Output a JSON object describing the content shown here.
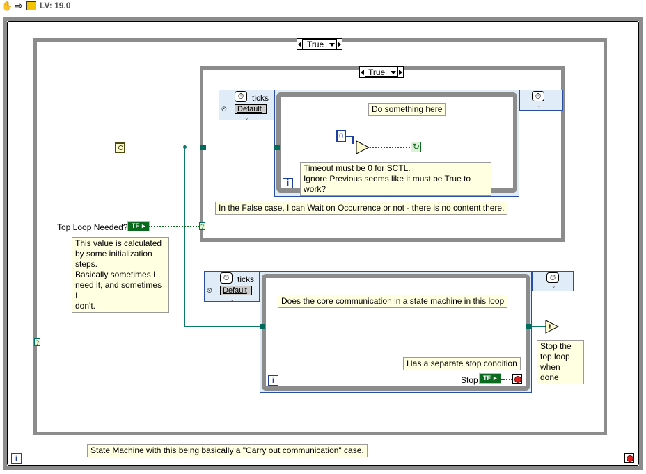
{
  "toolbar": {
    "version": "LV: 19.0",
    "icons": [
      "hand-icon",
      "arrow-icon",
      "lv-logo-icon"
    ]
  },
  "outer_case": {
    "selector_value": "True"
  },
  "inner_case": {
    "selector_value": "True"
  },
  "top_sctl": {
    "timing_ticks": "ticks",
    "timing_source": "Default",
    "comment_do": "Do something here",
    "constant_zero": "0",
    "comment_timeout_1": "Timeout must be 0 for SCTL.",
    "comment_timeout_2": "Ignore Previous seems like it must be True to work?",
    "iteration": "i"
  },
  "comment_false_case": "In the False case, I can Wait on Occurrence or not - there is no content there.",
  "top_loop_needed": {
    "label": "Top Loop Needed?",
    "terminal_text": "TF"
  },
  "comment_calc": [
    "This value is calculated",
    "by some initialization",
    "steps.",
    "Basically sometimes I",
    "need it, and sometimes I",
    "don't."
  ],
  "bottom_sctl": {
    "timing_ticks": "ticks",
    "timing_source": "Default",
    "comment_core": "Does the core communication in a state machine in this loop",
    "comment_stop": "Has a separate stop condition",
    "stop_label": "Stop",
    "stop_terminal": "TF",
    "iteration": "i"
  },
  "comment_stop_top": [
    "Stop the",
    "top loop",
    "when done"
  ],
  "comment_state_machine": "State Machine with this being basically a \"Carry out communication\" case.",
  "outer_loop": {
    "iteration": "i"
  },
  "colors": {
    "wire": "#0b7a6a",
    "boolean": "#0a6b1f",
    "frame": "#8c8c8c",
    "comment_bg": "#ffffe1",
    "timing_bg": "#e0ecf8"
  }
}
